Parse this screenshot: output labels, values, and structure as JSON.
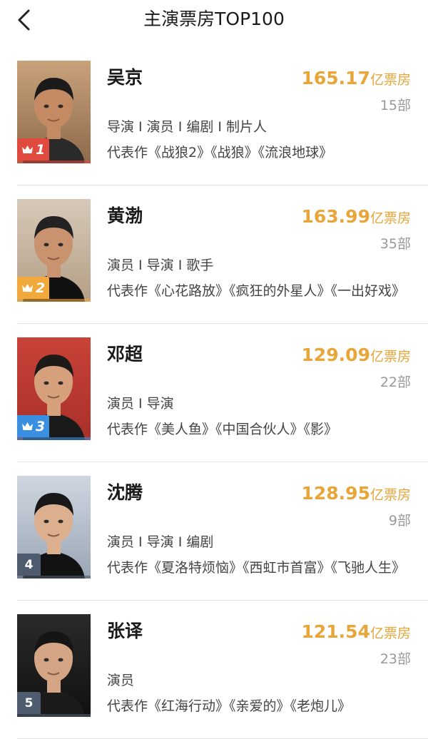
{
  "header": {
    "back_icon": "chevron-left-icon",
    "title": "主演票房TOP100"
  },
  "colors": {
    "accent": "#e7a53a",
    "rank1": "#e14a3e",
    "rank2": "#f0a93a",
    "rank3": "#3a8fe0",
    "rank_other": "#4f5b6e"
  },
  "actors": [
    {
      "rank": "1",
      "name": "吴京",
      "box_office": "165.17",
      "box_office_unit": "亿票房",
      "film_count": "15部",
      "roles": "导演 I 演员 I 编剧 I 制片人",
      "works": "代表作《战狼2》《战狼》《流浪地球》",
      "crown": true
    },
    {
      "rank": "2",
      "name": "黄渤",
      "box_office": "163.99",
      "box_office_unit": "亿票房",
      "film_count": "35部",
      "roles": "演员 I 导演 I 歌手",
      "works": "代表作《心花路放》《疯狂的外星人》《一出好戏》",
      "crown": true
    },
    {
      "rank": "3",
      "name": "邓超",
      "box_office": "129.09",
      "box_office_unit": "亿票房",
      "film_count": "22部",
      "roles": "演员 I 导演",
      "works": "代表作《美人鱼》《中国合伙人》《影》",
      "crown": true
    },
    {
      "rank": "4",
      "name": "沈腾",
      "box_office": "128.95",
      "box_office_unit": "亿票房",
      "film_count": "9部",
      "roles": "演员 I 导演 I 编剧",
      "works": "代表作《夏洛特烦恼》《西虹市首富》《飞驰人生》",
      "crown": false
    },
    {
      "rank": "5",
      "name": "张译",
      "box_office": "121.54",
      "box_office_unit": "亿票房",
      "film_count": "23部",
      "roles": "演员",
      "works": "代表作《红海行动》《亲爱的》《老炮儿》",
      "crown": false
    }
  ]
}
